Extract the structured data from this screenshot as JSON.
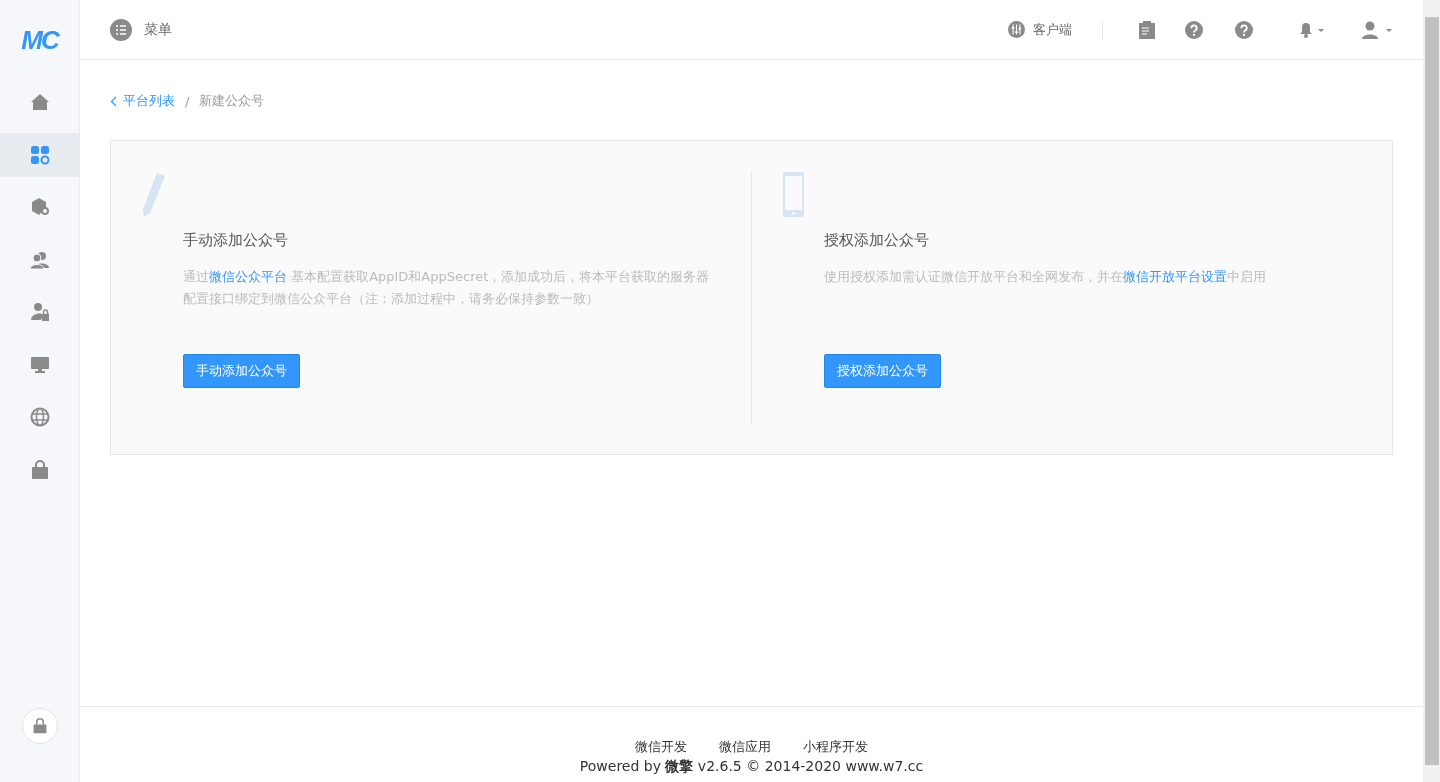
{
  "logo": "MC",
  "sidebar": {
    "items": [
      {
        "selected": false
      },
      {
        "selected": true
      },
      {
        "selected": false
      },
      {
        "selected": false
      },
      {
        "selected": false
      },
      {
        "selected": false
      },
      {
        "selected": false
      },
      {
        "selected": false
      }
    ]
  },
  "header": {
    "menu_label": "菜单",
    "client_label": "客户端"
  },
  "breadcrumb": {
    "back": "平台列表",
    "separator": "/",
    "current": "新建公众号"
  },
  "cards": [
    {
      "kind": "pencil",
      "title": "手动添加公众号",
      "description": [
        {
          "kind": "text",
          "text": "通过"
        },
        {
          "kind": "link",
          "text": "微信公众平台"
        },
        {
          "kind": "text",
          "text": " 基本配置获取AppID和AppSecret，添加成功后，将本平台获取的服务器配置接口绑定到微信公众平台（注：添加过程中，请务必保持参数一致）"
        }
      ],
      "button": "手动添加公众号"
    },
    {
      "kind": "phone",
      "title": "授权添加公众号",
      "description": [
        {
          "kind": "text",
          "text": "使用授权添加需认证微信开放平台和全网发布，并在"
        },
        {
          "kind": "link",
          "text": "微信开放平台设置"
        },
        {
          "kind": "text",
          "text": "中启用"
        }
      ],
      "button": "授权添加公众号"
    }
  ],
  "footer": {
    "links": [
      "微信开发",
      "微信应用",
      "小程序开发"
    ],
    "copyright": "Powered by **微擎** v2.6.5 © 2014-2020 www.w7.cc"
  }
}
